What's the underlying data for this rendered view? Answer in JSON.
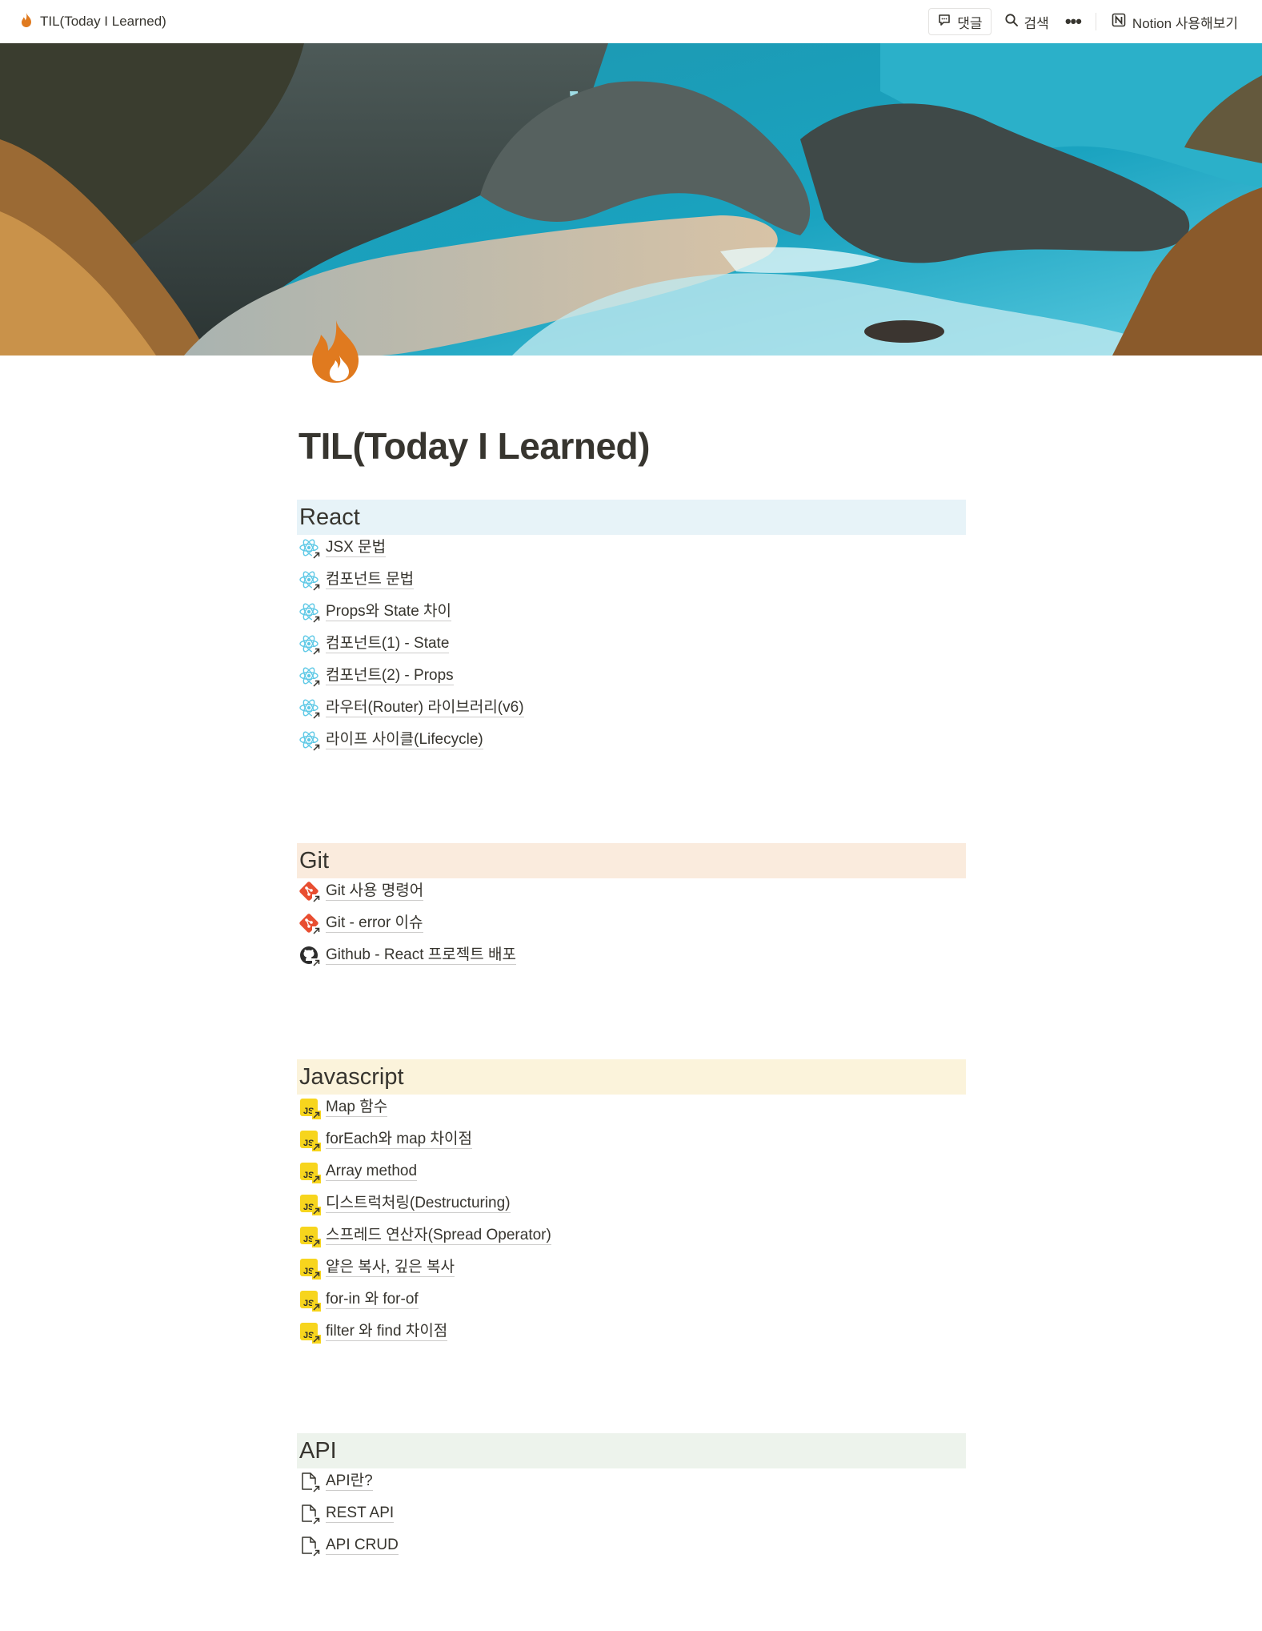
{
  "topbar": {
    "page_title": "TIL(Today I Learned)",
    "comment_label": "댓글",
    "search_label": "검색",
    "more_label": "•••",
    "notion_label": "Notion 사용해보기"
  },
  "page": {
    "title": "TIL(Today I Learned)",
    "icon": "fire-icon"
  },
  "sections": {
    "react": {
      "heading": "React",
      "color": "#e7f3f8",
      "icon": "react-icon",
      "items": [
        "JSX 문법",
        "컴포넌트 문법",
        "Props와 State 차이",
        "컴포넌트(1) - State",
        "컴포넌트(2) - Props",
        "라우터(Router) 라이브러리(v6)",
        "라이프 사이클(Lifecycle)"
      ]
    },
    "git": {
      "heading": "Git",
      "color": "#faebdd",
      "items": [
        "Git 사용 명령어",
        "Git - error 이슈",
        "Github - React 프로젝트 배포"
      ],
      "icons": [
        "git-icon",
        "git-icon",
        "github-icon"
      ]
    },
    "javascript": {
      "heading": "Javascript",
      "color": "#fbf3db",
      "icon": "js-icon",
      "items": [
        "Map 함수",
        "forEach와 map 차이점",
        "Array method",
        "디스트럭처링(Destructuring)",
        "스프레드 연산자(Spread Operator)",
        "얕은 복사, 깊은 복사",
        "for-in 와 for-of",
        "filter 와 find 차이점"
      ]
    },
    "api": {
      "heading": "API",
      "color": "#edf3ec",
      "icon": "page-link-icon",
      "items": [
        "API란?",
        "REST API",
        "API CRUD"
      ]
    }
  }
}
